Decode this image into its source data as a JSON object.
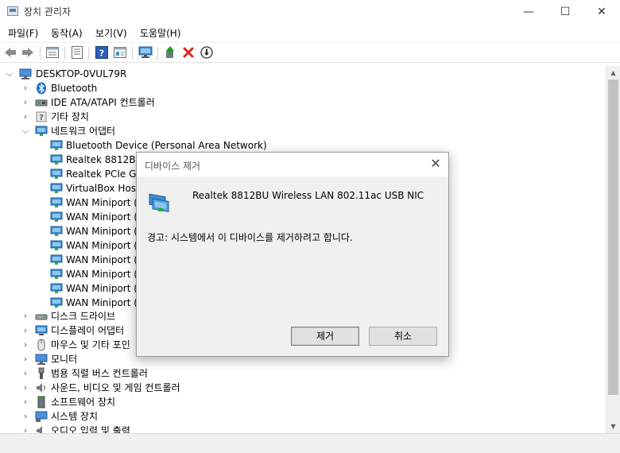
{
  "window": {
    "title": "장치 관리자",
    "minimize": "—",
    "maximize": "☐",
    "close": "✕"
  },
  "menu": [
    "파일(F)",
    "동작(A)",
    "보기(V)",
    "도움말(H)"
  ],
  "toolbar_icons": [
    "back-icon",
    "forward-icon",
    "properties-icon",
    "list-icon",
    "help-icon",
    "view-icon",
    "monitor-icon",
    "update-driver-icon",
    "uninstall-icon",
    "disable-icon"
  ],
  "tree": {
    "root": "DESKTOP-0VUL79R",
    "bluetooth": "Bluetooth",
    "ide": "IDE ATA/ATAPI 컨트롤러",
    "other": "기타 장치",
    "network": "네트워크 어댑터",
    "net_items": [
      "Bluetooth Device (Personal Area Network)",
      "Realtek 8812BU",
      "Realtek PCIe GbE",
      "VirtualBox Host-",
      "WAN Miniport (I",
      "WAN Miniport (I",
      "WAN Miniport (I",
      "WAN Miniport (L",
      "WAN Miniport (N",
      "WAN Miniport (P",
      "WAN Miniport (P",
      "WAN Miniport (S"
    ],
    "disk": "디스크 드라이브",
    "display": "디스플레이 어댑터",
    "mouse": "마우스 및 기타 포인",
    "monitor": "모니터",
    "usb": "범용 직렬 버스 컨트롤러",
    "sound": "사운드, 비디오 및 게임 컨트롤러",
    "software": "소프트웨어 장치",
    "system": "시스템 장치",
    "audio": "오디오 입력 및 출력"
  },
  "dialog": {
    "title": "디바이스 제거",
    "close": "✕",
    "device_name": "Realtek 8812BU Wireless LAN 802.11ac USB NIC",
    "warning": "경고: 시스템에서 이 디바이스를 제거하려고 합니다.",
    "confirm_label": "제거",
    "cancel_label": "취소"
  },
  "colors": {
    "accent": "#2b7fd8",
    "monitor_icon": "#3e8ed0",
    "uninstall_red": "#e2261c",
    "update_green": "#1f9b2e",
    "help_blue": "#2c5fb5"
  }
}
